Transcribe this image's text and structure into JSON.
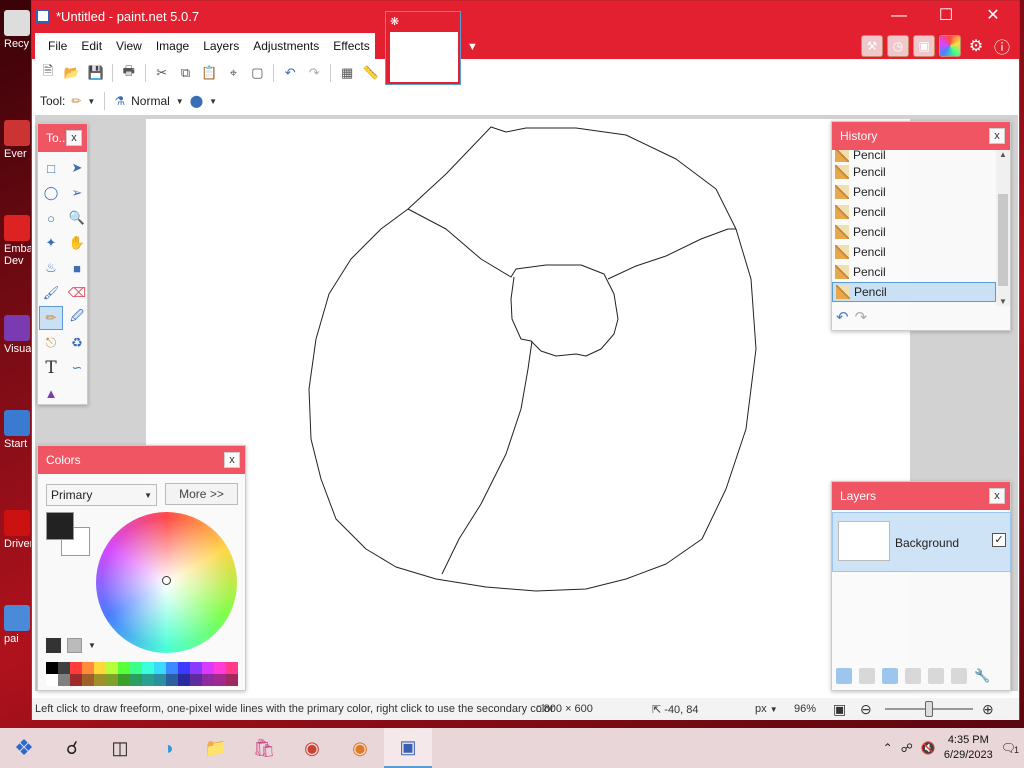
{
  "window": {
    "title": "*Untitled - paint.net 5.0.7"
  },
  "desktop_icons": [
    "Recy",
    "Ever",
    "Emba Dev",
    "Visua",
    "Start",
    "Driver",
    "pai"
  ],
  "menu": [
    "File",
    "Edit",
    "View",
    "Image",
    "Layers",
    "Adjustments",
    "Effects"
  ],
  "toolbar2": {
    "tool_label": "Tool:",
    "blend_mode": "Normal"
  },
  "tools_panel": {
    "title": "To...",
    "close": "x"
  },
  "colors_panel": {
    "title": "Colors",
    "close": "x",
    "mode": "Primary",
    "more_label": "More >>"
  },
  "history_panel": {
    "title": "History",
    "close": "x",
    "items": [
      "Pencil",
      "Pencil",
      "Pencil",
      "Pencil",
      "Pencil",
      "Pencil",
      "Pencil",
      "Pencil"
    ]
  },
  "layers_panel": {
    "title": "Layers",
    "close": "x",
    "layer_name": "Background",
    "visible_check": "✓"
  },
  "statusbar": {
    "hint": "Left click to draw freeform, one-pixel wide lines with the primary color, right click to use the secondary color",
    "image_size": "800 × 600",
    "cursor": "-40, 84",
    "unit": "px",
    "zoom": "96%"
  },
  "taskbar": {
    "time": "4:35 PM",
    "date": "6/29/2023",
    "notification_count": "1"
  },
  "colors": {
    "accent": "#e3202f",
    "panel_head": "#ef5563",
    "selection": "#c9e0f5"
  }
}
